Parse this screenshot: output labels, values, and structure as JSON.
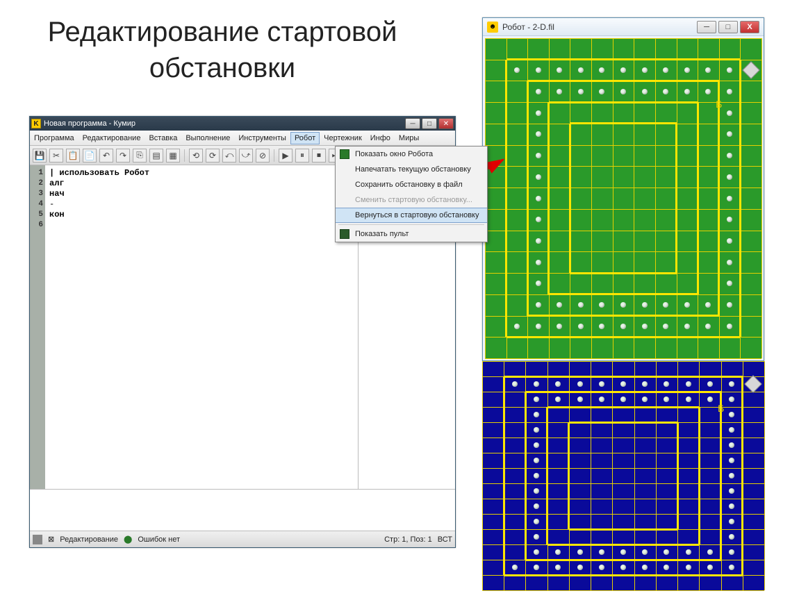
{
  "slide_title": "Редактирование стартовой обстановки",
  "kumir": {
    "title": "Новая программа - Кумир",
    "menu": [
      "Программа",
      "Редактирование",
      "Вставка",
      "Выполнение",
      "Инструменты",
      "Робот",
      "Чертежник",
      "Инфо",
      "Миры"
    ],
    "code_lines": [
      "| использовать Робот",
      "алг",
      "нач",
      "-",
      "кон",
      ""
    ],
    "gutter": [
      "1",
      "2",
      "3",
      "4",
      "5",
      "6"
    ],
    "status": {
      "mode": "Редактирование",
      "errors": "Ошибок нет",
      "pos": "Стр: 1, Поз: 1",
      "ins": "ВСТ"
    }
  },
  "dropdown": {
    "items": [
      {
        "label": "Показать окно Робота",
        "icon": "green"
      },
      {
        "label": "Напечатать текущую обстановку"
      },
      {
        "label": "Сохранить обстановку в файл"
      },
      {
        "label": "Сменить стартовую обстановку...",
        "disabled": true
      },
      {
        "label": "Вернуться в стартовую обстановку",
        "hover": true
      },
      {
        "label": "Показать пульт",
        "icon": "dark",
        "sep_before": true
      }
    ]
  },
  "robot": {
    "title": "Робот - 2-D.fil",
    "cols": 13,
    "rows": 15,
    "label": "Б",
    "diamond": {
      "c": 12.5,
      "r": 1.5
    },
    "walls_h": [
      {
        "c1": 1,
        "c2": 12,
        "r": 1
      },
      {
        "c1": 2,
        "c2": 11,
        "r": 2
      },
      {
        "c1": 3,
        "c2": 10,
        "r": 3
      },
      {
        "c1": 4,
        "c2": 9,
        "r": 4
      },
      {
        "c1": 4,
        "c2": 9,
        "r": 11
      },
      {
        "c1": 3,
        "c2": 10,
        "r": 12
      },
      {
        "c1": 2,
        "c2": 11,
        "r": 13
      },
      {
        "c1": 1,
        "c2": 12,
        "r": 14
      }
    ],
    "walls_v": [
      {
        "c": 1,
        "r1": 1,
        "r2": 14
      },
      {
        "c": 2,
        "r1": 2,
        "r2": 13
      },
      {
        "c": 3,
        "r1": 3,
        "r2": 12
      },
      {
        "c": 4,
        "r1": 4,
        "r2": 11
      },
      {
        "c": 9,
        "r1": 4,
        "r2": 11
      },
      {
        "c": 10,
        "r1": 3,
        "r2": 12
      },
      {
        "c": 11,
        "r1": 2,
        "r2": 13
      },
      {
        "c": 12,
        "r1": 1,
        "r2": 14
      }
    ],
    "dots": [
      [
        1.5,
        1.5
      ],
      [
        2.5,
        1.5
      ],
      [
        3.5,
        1.5
      ],
      [
        4.5,
        1.5
      ],
      [
        5.5,
        1.5
      ],
      [
        6.5,
        1.5
      ],
      [
        7.5,
        1.5
      ],
      [
        8.5,
        1.5
      ],
      [
        9.5,
        1.5
      ],
      [
        10.5,
        1.5
      ],
      [
        11.5,
        1.5
      ],
      [
        2.5,
        2.5
      ],
      [
        3.5,
        2.5
      ],
      [
        4.5,
        2.5
      ],
      [
        5.5,
        2.5
      ],
      [
        6.5,
        2.5
      ],
      [
        7.5,
        2.5
      ],
      [
        8.5,
        2.5
      ],
      [
        9.5,
        2.5
      ],
      [
        10.5,
        2.5
      ],
      [
        11.5,
        2.5
      ],
      [
        2.5,
        3.5
      ],
      [
        11.5,
        3.5
      ],
      [
        2.5,
        4.5
      ],
      [
        11.5,
        4.5
      ],
      [
        2.5,
        5.5
      ],
      [
        11.5,
        5.5
      ],
      [
        2.5,
        6.5
      ],
      [
        11.5,
        6.5
      ],
      [
        2.5,
        7.5
      ],
      [
        11.5,
        7.5
      ],
      [
        2.5,
        8.5
      ],
      [
        11.5,
        8.5
      ],
      [
        2.5,
        9.5
      ],
      [
        11.5,
        9.5
      ],
      [
        2.5,
        10.5
      ],
      [
        11.5,
        10.5
      ],
      [
        2.5,
        11.5
      ],
      [
        11.5,
        11.5
      ],
      [
        2.5,
        12.5
      ],
      [
        3.5,
        12.5
      ],
      [
        4.5,
        12.5
      ],
      [
        5.5,
        12.5
      ],
      [
        6.5,
        12.5
      ],
      [
        7.5,
        12.5
      ],
      [
        8.5,
        12.5
      ],
      [
        9.5,
        12.5
      ],
      [
        10.5,
        12.5
      ],
      [
        11.5,
        12.5
      ],
      [
        1.5,
        13.5
      ],
      [
        2.5,
        13.5
      ],
      [
        3.5,
        13.5
      ],
      [
        4.5,
        13.5
      ],
      [
        5.5,
        13.5
      ],
      [
        6.5,
        13.5
      ],
      [
        7.5,
        13.5
      ],
      [
        8.5,
        13.5
      ],
      [
        9.5,
        13.5
      ],
      [
        10.5,
        13.5
      ],
      [
        11.5,
        13.5
      ]
    ]
  }
}
